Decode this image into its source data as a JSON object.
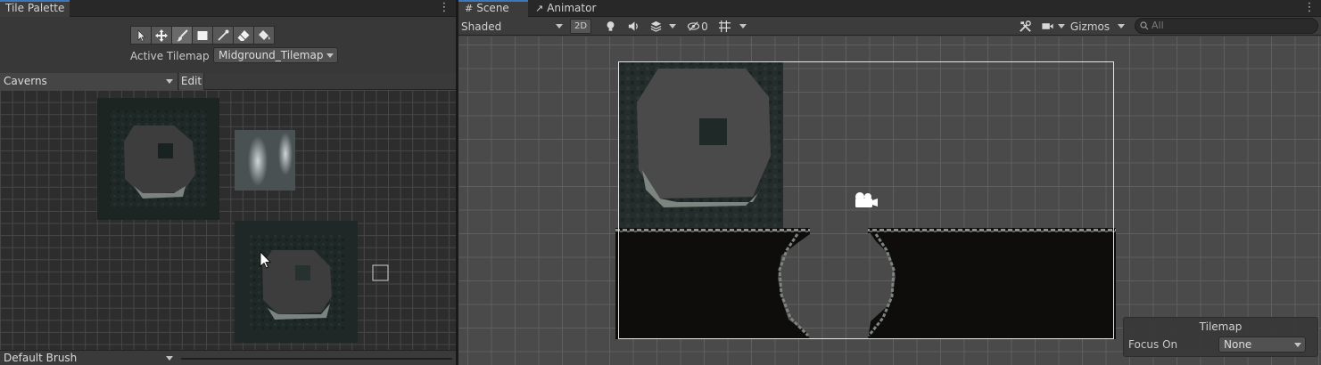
{
  "tile_palette": {
    "tab_title": "Tile Palette",
    "active_tilemap_label": "Active Tilemap",
    "active_tilemap_value": "Midground_Tilemap",
    "palette_value": "Caverns",
    "edit_label": "Edit",
    "brush_value": "Default Brush",
    "tools": [
      "select-tool",
      "move-tool",
      "paint-brush-tool",
      "box-fill-tool",
      "pick-tool",
      "erase-tool",
      "flood-fill-tool"
    ],
    "selected_tool": "paint-brush-tool"
  },
  "scene": {
    "tabs": [
      {
        "label": "Scene",
        "icon": "grid-icon"
      },
      {
        "label": "Animator",
        "icon": "animator-icon"
      }
    ],
    "shading_mode": "Shaded",
    "toggle_2d": "2D",
    "hidden_count": "0",
    "gizmos_label": "Gizmos",
    "search_placeholder": "All",
    "overlay": {
      "title": "Tilemap",
      "focus_label": "Focus On",
      "focus_value": "None"
    }
  },
  "colors": {
    "panel": "#383838",
    "tabbar": "#282828",
    "accent": "#3a79bb",
    "scene_bg": "#4a4a4a",
    "tile_dark": "#0f0e0d"
  }
}
